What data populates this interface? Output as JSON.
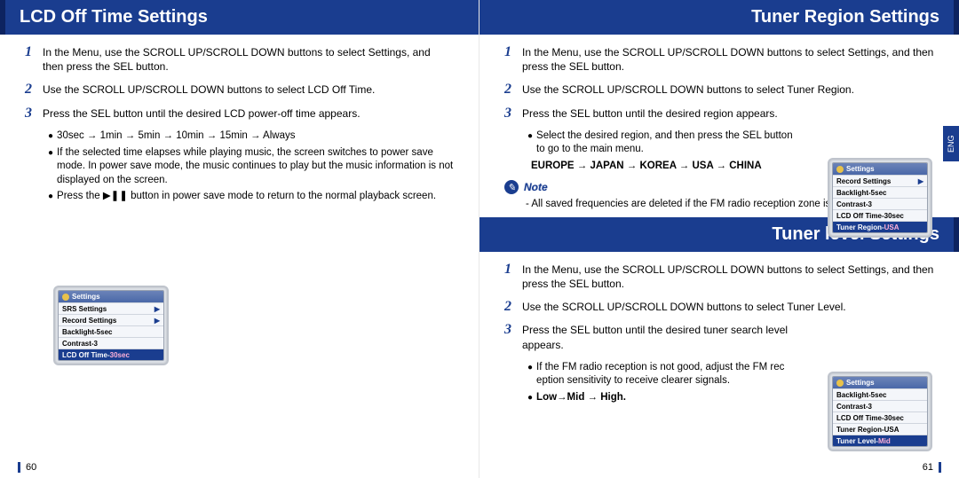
{
  "lang_tab": "ENG",
  "page_left_num": "60",
  "page_right_num": "61",
  "left": {
    "heading": "LCD Off Time Settings",
    "step1": "In the Menu, use the SCROLL UP/SCROLL DOWN buttons to select Settings, and then press the SEL button.",
    "step2": "Use the SCROLL UP/SCROLL DOWN buttons to select LCD Off Time.",
    "step3": "Press the SEL button until the desired LCD power-off time appears.",
    "sub1": "30sec → 1min → 5min → 10min → 15min → Always",
    "sub2": "If the selected time elapses while playing music, the screen switches to power save mode. In power save mode, the music continues to play but the music information is not displayed on the screen.",
    "sub3": "Press the ▶❚❚ button in power save mode to return to the normal playback screen.",
    "screen": {
      "title": "Settings",
      "rows": [
        {
          "label": "SRS Settings",
          "hasArrow": true
        },
        {
          "label": "Record Settings",
          "hasArrow": true
        },
        {
          "label": "Backlight-5sec"
        },
        {
          "label": "Contrast-3"
        },
        {
          "label_html": "LCD Off Time-<span class='val30'>30sec</span>",
          "selected": true
        }
      ]
    }
  },
  "right_top": {
    "heading": "Tuner Region Settings",
    "step1": "In the Menu, use the SCROLL UP/SCROLL DOWN buttons to select Settings, and then press the SEL button.",
    "step2": "Use the SCROLL UP/SCROLL DOWN buttons to select Tuner Region.",
    "step3": "Press the SEL button until the desired region appears.",
    "sub1": "Select the desired region, and then press the SEL button to go to the main menu.",
    "sub2": "EUROPE → JAPAN → KOREA → USA → CHINA",
    "note_label": "Note",
    "note_text": "- All saved frequencies are deleted if the FM radio reception zone is changed.",
    "screen": {
      "title": "Settings",
      "rows": [
        {
          "label": "Record Settings",
          "hasArrow": true
        },
        {
          "label": "Backlight-5sec"
        },
        {
          "label": "Contrast-3"
        },
        {
          "label": "LCD Off Time-30sec"
        },
        {
          "label_html": "Tuner Region-<span class='valusa'>USA</span>",
          "selected": true
        }
      ]
    }
  },
  "right_bottom": {
    "heading": "Tuner level Settings",
    "step1": "In the Menu, use the SCROLL UP/SCROLL DOWN buttons to select Settings, and then press the SEL button.",
    "step2": "Use the SCROLL UP/SCROLL DOWN buttons to select Tuner Level.",
    "step3": "Press the SEL button until the desired tuner search level appears.",
    "sub1": "If the FM radio reception is not good, adjust the FM rec eption sensitivity to receive clearer signals.",
    "sub2": "Low→Mid → High.",
    "screen": {
      "title": "Settings",
      "rows": [
        {
          "label": "Backlight-5sec"
        },
        {
          "label": "Contrast-3"
        },
        {
          "label": "LCD Off Time-30sec"
        },
        {
          "label": "Tuner Region-USA"
        },
        {
          "label_html": "Tuner  Level-<span class='valusa'>Mid</span>",
          "selected": true
        }
      ]
    }
  }
}
